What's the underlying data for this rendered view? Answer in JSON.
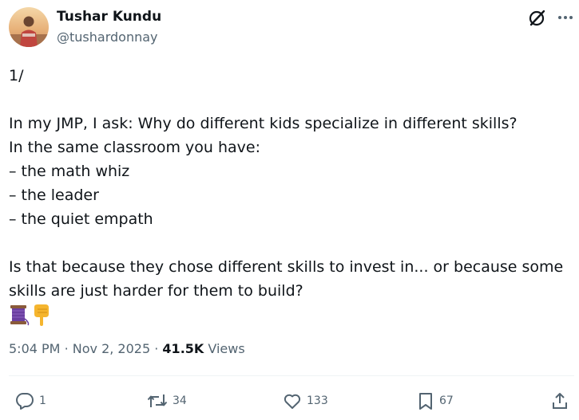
{
  "author": {
    "name": "Tushar Kundu",
    "handle": "@tushardonnay"
  },
  "tweet": {
    "lines": [
      "1/",
      "",
      "In my JMP, I ask: Why do different kids specialize in different skills?",
      "In the same classroom you have:",
      "– the math whiz",
      "– the leader",
      "– the quiet empath",
      "",
      "Is that because they chose different skills to invest in... or because some",
      "skills are just harder for them to build?"
    ],
    "emojis": [
      "thread-spool-emoji",
      "pointing-down-emoji"
    ]
  },
  "meta": {
    "time": "5:04 PM",
    "separator": "·",
    "date": "Nov 2, 2025",
    "views_count": "41.5K",
    "views_label": "Views"
  },
  "actions": {
    "replies": "1",
    "reposts": "34",
    "likes": "133",
    "bookmarks": "67"
  },
  "icons": [
    "grok-icon",
    "more-icon",
    "reply-icon",
    "repost-icon",
    "like-icon",
    "bookmark-icon",
    "share-icon"
  ],
  "colors": {
    "text": "#0f1419",
    "secondary": "#536471",
    "divider": "#eff3f4",
    "spool": "#6a3fa0",
    "pointing": "#f5b52e"
  }
}
